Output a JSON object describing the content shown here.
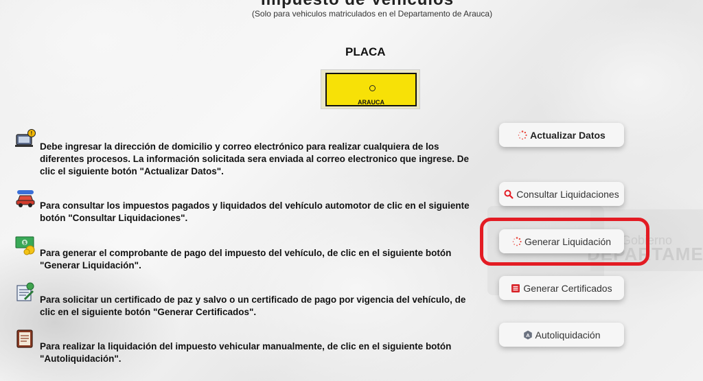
{
  "page": {
    "title_partial": "Impuesto de Vehículos",
    "subtitle": "(Solo para vehiculos matriculados en el Departamento de Arauca)",
    "plate_section_label": "PLACA",
    "plate_city": "ARAUCA"
  },
  "instructions": [
    {
      "icon": "laptop-warning-icon",
      "text": "Debe ingresar la dirección de domicilio y correo electrónico para realizar cualquiera de los diferentes procesos. La información solicitada sera enviada al correo electronico que ingrese. De clic el siguiente botón \"Actualizar Datos\"."
    },
    {
      "icon": "car-icon",
      "text": "Para consultar los impuestos pagados y liquidados del vehículo automotor de clic en el siguiente botón \"Consultar Liquidaciones\"."
    },
    {
      "icon": "money-icon",
      "text": "Para generar el comprobante de pago del impuesto del vehículo, de clic en el siguiente botón \"Generar Liquidación\"."
    },
    {
      "icon": "certificate-icon",
      "text": "Para solicitar un certificado de paz y salvo o un certificado de pago por vigencia del vehículo, de clic en el siguiente botón \"Generar Certificados\"."
    },
    {
      "icon": "ledger-icon",
      "text": "Para realizar la liquidación del impuesto vehicular manualmente, de clic en el siguiente botón \"Autoliquidación\"."
    }
  ],
  "buttons": {
    "update": "Actualizar Datos",
    "consult": "Consultar Liquidaciones",
    "generate": "Generar Liquidación",
    "certificates": "Generar Certificados",
    "self": "Autoliquidación"
  },
  "watermark": {
    "small": "Gobierno",
    "large": "DEPARTAMENTO"
  },
  "colors": {
    "plate_yellow": "#f7e107",
    "highlight_red": "#e31b23",
    "spinner_red": "#e8483e"
  }
}
